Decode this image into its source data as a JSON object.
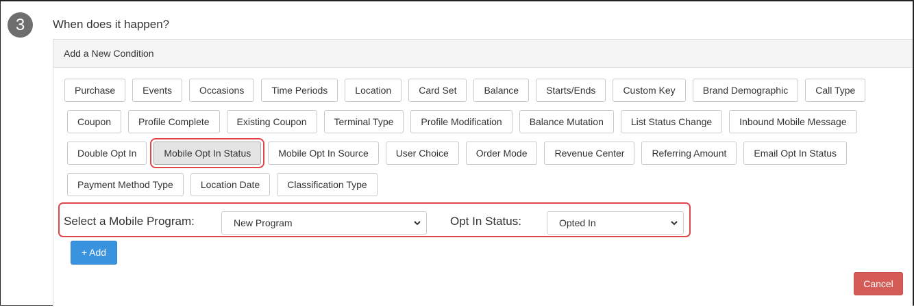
{
  "step": {
    "number": "3",
    "title": "When does it happen?"
  },
  "panel": {
    "heading": "Add a New Condition"
  },
  "condition_rows": [
    [
      "Purchase",
      "Events",
      "Occasions",
      "Time Periods",
      "Location",
      "Card Set",
      "Balance",
      "Starts/Ends",
      "Custom Key",
      "Brand Demographic",
      "Call Type"
    ],
    [
      "Coupon",
      "Profile Complete",
      "Existing Coupon",
      "Terminal Type",
      "Profile Modification",
      "Balance Mutation",
      "List Status Change",
      "Inbound Mobile Message"
    ],
    [
      "Double Opt In",
      "Mobile Opt In Status",
      "Mobile Opt In Source",
      "User Choice",
      "Order Mode",
      "Revenue Center",
      "Referring Amount",
      "Email Opt In Status"
    ],
    [
      "Payment Method Type",
      "Location Date",
      "Classification Type"
    ]
  ],
  "selected_condition": "Mobile Opt In Status",
  "program": {
    "label": "Select a Mobile Program:",
    "value": "New Program"
  },
  "opt_in": {
    "label": "Opt In Status:",
    "value": "Opted In"
  },
  "actions": {
    "add_label": "+ Add",
    "cancel_label": "Cancel"
  },
  "colors": {
    "highlight": "#e0454a",
    "add": "#3a93de",
    "cancel": "#d45b56"
  }
}
